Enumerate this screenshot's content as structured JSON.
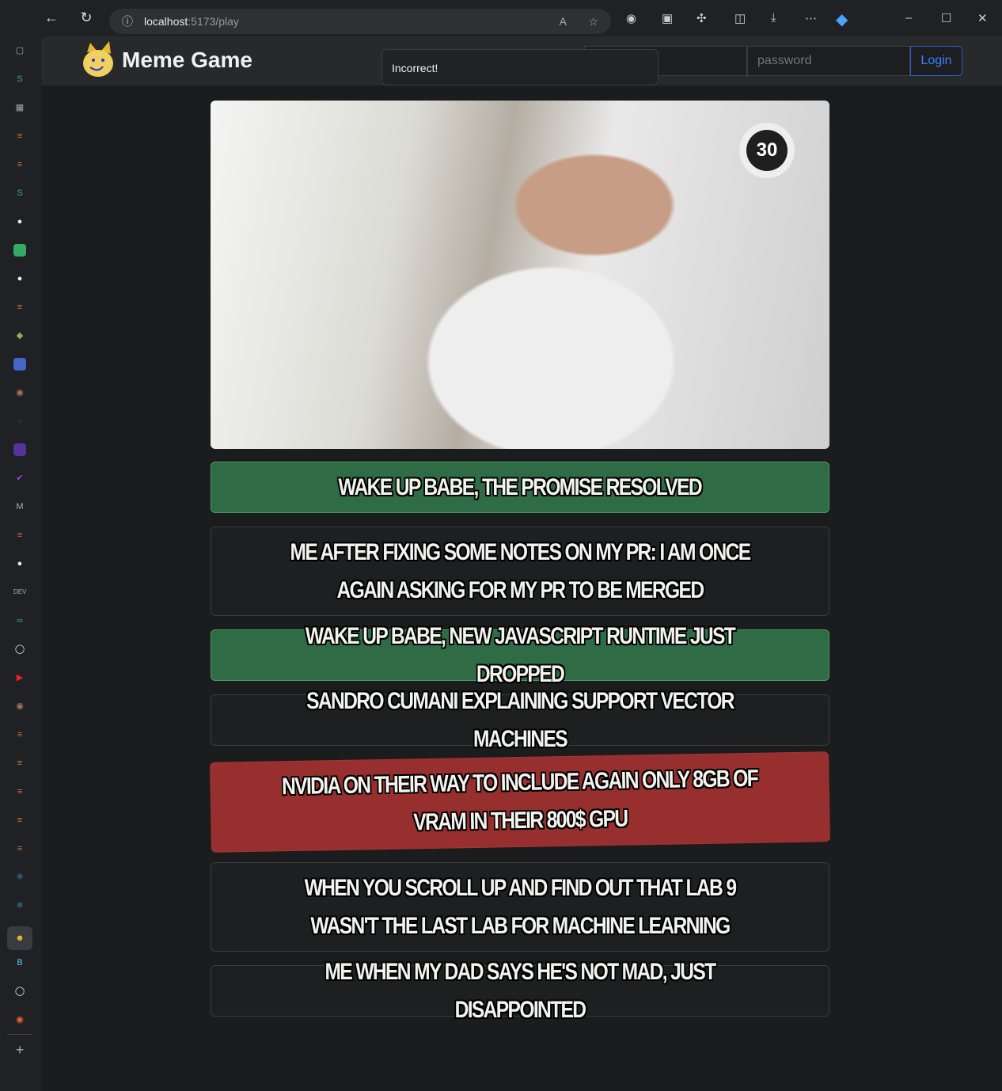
{
  "browser": {
    "url_host": "localhost",
    "url_path": ":5173/play"
  },
  "header": {
    "brand": "Meme Game",
    "toast": "Incorrect!",
    "username_placeholder": "",
    "password_placeholder": "password",
    "login_label": "Login"
  },
  "game": {
    "timer": "30"
  },
  "options": [
    {
      "text": "Wake up babe, the promise resolved",
      "state": "correct"
    },
    {
      "text": "Me after fixing some notes on my PR: I am once again asking for my PR to be merged",
      "state": "neutral"
    },
    {
      "text": "Wake up babe, new JavaScript runtime just dropped",
      "state": "correct"
    },
    {
      "text": "Sandro Cumani explaining Support Vector Machines",
      "state": "neutral"
    },
    {
      "text": "Nvidia on their way to include again only 8GB of VRAM in their 800$ GPU",
      "state": "wrong"
    },
    {
      "text": "When you scroll up and find out that lab 9 wasn't the last lab for Machine Learning",
      "state": "neutral"
    },
    {
      "text": "Me when my dad says he's not mad, just disappointed",
      "state": "neutral"
    }
  ],
  "colors": {
    "correct": "#2f6b45",
    "wrong": "#962f2e",
    "accent": "#3b82f6"
  }
}
